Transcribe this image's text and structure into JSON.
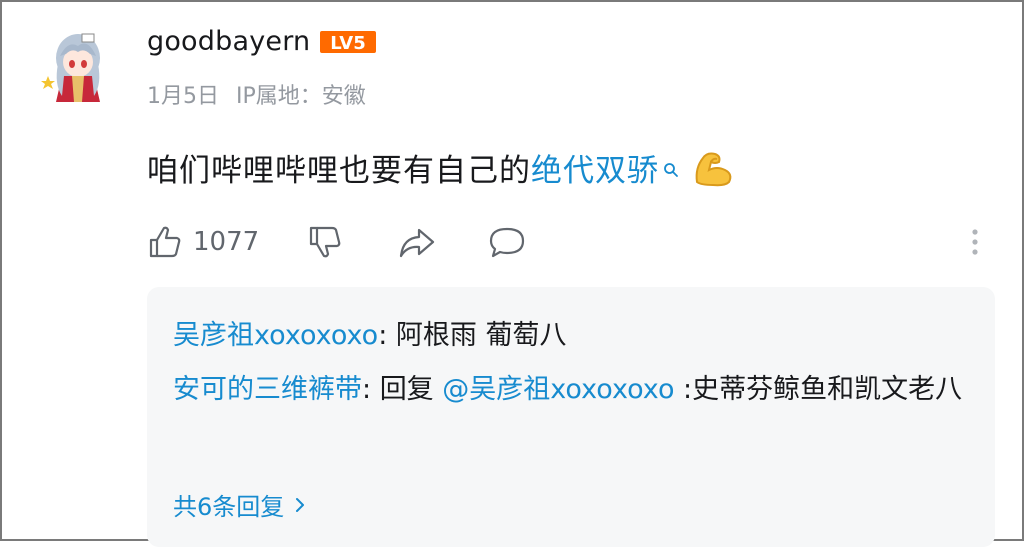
{
  "comment": {
    "username": "goodbayern",
    "level_badge": "LV5",
    "date": "1月5日",
    "ip_location": "IP属地：安徽",
    "text_before_link": "咱们哔哩哔哩也要有自己的",
    "link_text": "绝代双骄",
    "like_count": "1077"
  },
  "replies": [
    {
      "author": "吴彦祖xoxoxoxo",
      "separator": ": ",
      "text": "阿根雨 葡萄八"
    },
    {
      "author": "安可的三维裤带",
      "separator": ": ",
      "prefix": "回复 ",
      "mention": "@吴彦祖xoxoxoxo",
      "text": " :史蒂芬鲸鱼和凯文老八"
    }
  ],
  "more_replies": "共6条回复",
  "colors": {
    "link": "#178bcf",
    "meta": "#9499a0",
    "badge": "#ff6a00",
    "reply_bg": "#f6f7f8"
  },
  "icons": [
    "avatar-anime-girl",
    "level-badge",
    "search-icon",
    "flexed-biceps-emoji",
    "thumbs-up-icon",
    "thumbs-down-icon",
    "share-icon",
    "comment-icon",
    "more-vertical-icon",
    "chevron-right-icon"
  ]
}
